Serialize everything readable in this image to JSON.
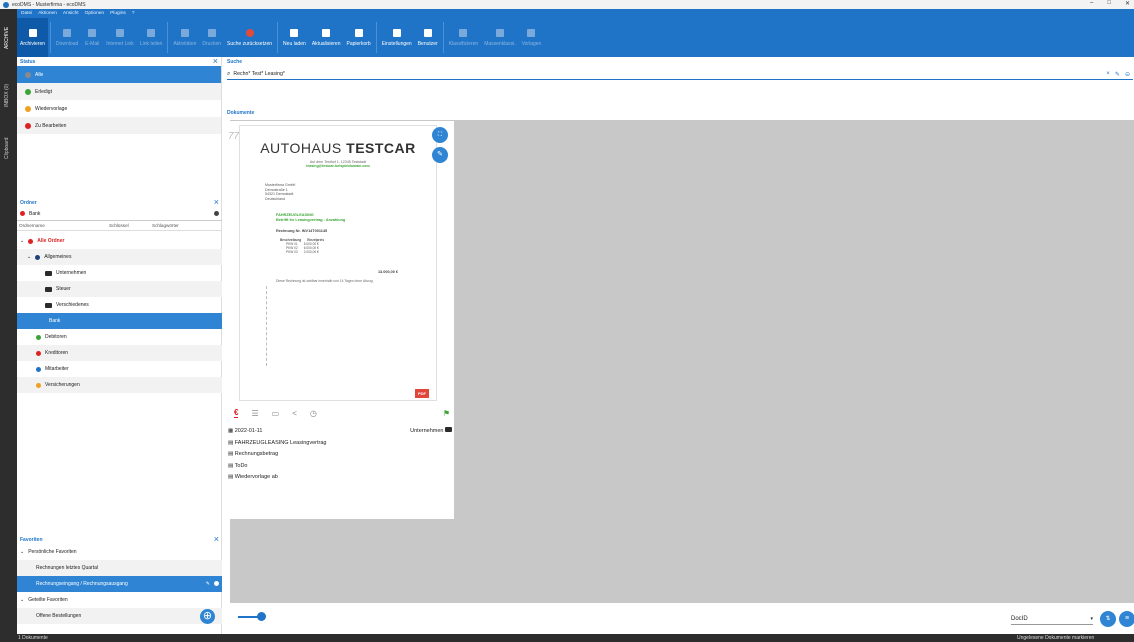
{
  "window": {
    "title": "ecoDMS - Musterfirma - ecoDMS",
    "controls": [
      "–",
      "□",
      "✕"
    ]
  },
  "vertical_tabs": [
    "ARCHIVE",
    "INBOX (0)",
    "Clipboard"
  ],
  "menu": [
    "Datei",
    "Aktionen",
    "Ansicht",
    "Optionen",
    "Plugins",
    "?"
  ],
  "toolbar": [
    {
      "label": "Archivieren",
      "state": "active",
      "icon": "archive-icon"
    },
    {
      "label": "Download",
      "state": "disabled",
      "icon": "download-icon"
    },
    {
      "label": "E-Mail",
      "state": "disabled",
      "icon": "mail-icon"
    },
    {
      "label": "Internet Link",
      "state": "disabled",
      "icon": "link-icon"
    },
    {
      "label": "Link teilen",
      "state": "disabled",
      "icon": "share-icon"
    },
    {
      "label": "Aktivitäten",
      "state": "disabled",
      "icon": "history-icon"
    },
    {
      "label": "Drucken",
      "state": "disabled",
      "icon": "print-icon"
    },
    {
      "label": "Suche zurücksetzen",
      "state": "enabled",
      "icon": "reset-search-icon"
    },
    {
      "label": "Neu laden",
      "state": "enabled",
      "icon": "reload-icon"
    },
    {
      "label": "Aktualisieren",
      "state": "enabled",
      "icon": "refresh-icon"
    },
    {
      "label": "Papierkorb",
      "state": "enabled",
      "icon": "trash-icon"
    },
    {
      "label": "Einstellungen",
      "state": "enabled",
      "icon": "gear-icon"
    },
    {
      "label": "Benutzer",
      "state": "enabled",
      "icon": "users-icon"
    },
    {
      "label": "Klassifizieren",
      "state": "disabled",
      "icon": "classify-icon"
    },
    {
      "label": "Massenklassi.",
      "state": "disabled",
      "icon": "mass-classify-icon"
    },
    {
      "label": "Vorlagen",
      "state": "disabled",
      "icon": "templates-icon"
    }
  ],
  "status": {
    "title": "Status",
    "items": [
      {
        "label": "Alle",
        "color": "#8a8a8a",
        "selected": true
      },
      {
        "label": "Erledigt",
        "color": "#3aa535"
      },
      {
        "label": "Wiedervorlage",
        "color": "#f0a020"
      },
      {
        "label": "Zu Bearbeiten",
        "color": "#d22"
      }
    ]
  },
  "folders": {
    "title": "Ordner",
    "search_value": "Bank",
    "columns": [
      "Ordnername",
      "Schlüssel",
      "Schlagwörter"
    ],
    "root": "Alle Ordner",
    "group": "Allgemeines",
    "items": [
      {
        "label": "Unternehmen",
        "level": 2
      },
      {
        "label": "Steuer",
        "level": 2
      },
      {
        "label": "Verschiedenes",
        "level": 2
      },
      {
        "label": "Bank",
        "level": 2,
        "selected": true
      },
      {
        "label": "Debitoren",
        "level": 1,
        "color": "#3aa535"
      },
      {
        "label": "Kreditoren",
        "level": 1,
        "color": "#d22"
      },
      {
        "label": "Mitarbeiter",
        "level": 1,
        "color": "#1f74c7"
      },
      {
        "label": "Versicherungen",
        "level": 1,
        "color": "#f0a020"
      }
    ]
  },
  "favorites": {
    "title": "Favoriten",
    "personal": "Persönliche Favoriten",
    "items": [
      "Rechnungen letztes Quartal",
      "Rechnungseingang / Rechnungsausgang"
    ],
    "shared": "Geteilte Favoriten",
    "shared_items": [
      "Offene Bestellungen"
    ]
  },
  "search": {
    "title": "Suche",
    "query": "Rechn* Test* Leasing*"
  },
  "documents_label": "Dokumente",
  "document": {
    "number_partial": "77",
    "company_light": "AUTOHAUS ",
    "company_bold": "TESTCAR",
    "address_line": "Auf dem Testhof 1, 12345 Teststadt",
    "email": "leasing@testcar-beispieldomain.com",
    "recipient": [
      "Musterfirma GmbH",
      "Demostraße 1",
      "54321 Demostadt",
      "Deutschland"
    ],
    "subject1": "FAHRZEUGLEASING",
    "subject2": "Betrifft ihr Leasingvertrag - Anzahlung",
    "invoice": "Rechnung Nr. INV14T001145",
    "table_head": [
      "Beschreibung",
      "Einzelpreis"
    ],
    "rows": [
      [
        "PKW 01",
        "5.000,00 €"
      ],
      [
        "PKW 02",
        "6.000,00 €"
      ],
      [
        "PKW 03",
        "2.000,00 €"
      ]
    ],
    "total": "13.000,00 €",
    "footer": "Diese Rechnung ist zahlbar innerhalb von 14 Tagen ohne Abzug.",
    "badge": "PDF",
    "date": "2022-01-11",
    "folder": "Unternehmen",
    "type_line": "FAHRZEUGLEASING Leasingvertrag",
    "fields": [
      "Rechnungsbetrag",
      "ToDo",
      "Wiedervorlage ab"
    ]
  },
  "sort": {
    "value": "DocID"
  },
  "statusbar": {
    "count": "1 Dokumente",
    "right": "Ungelesene Dokumente markieren"
  }
}
